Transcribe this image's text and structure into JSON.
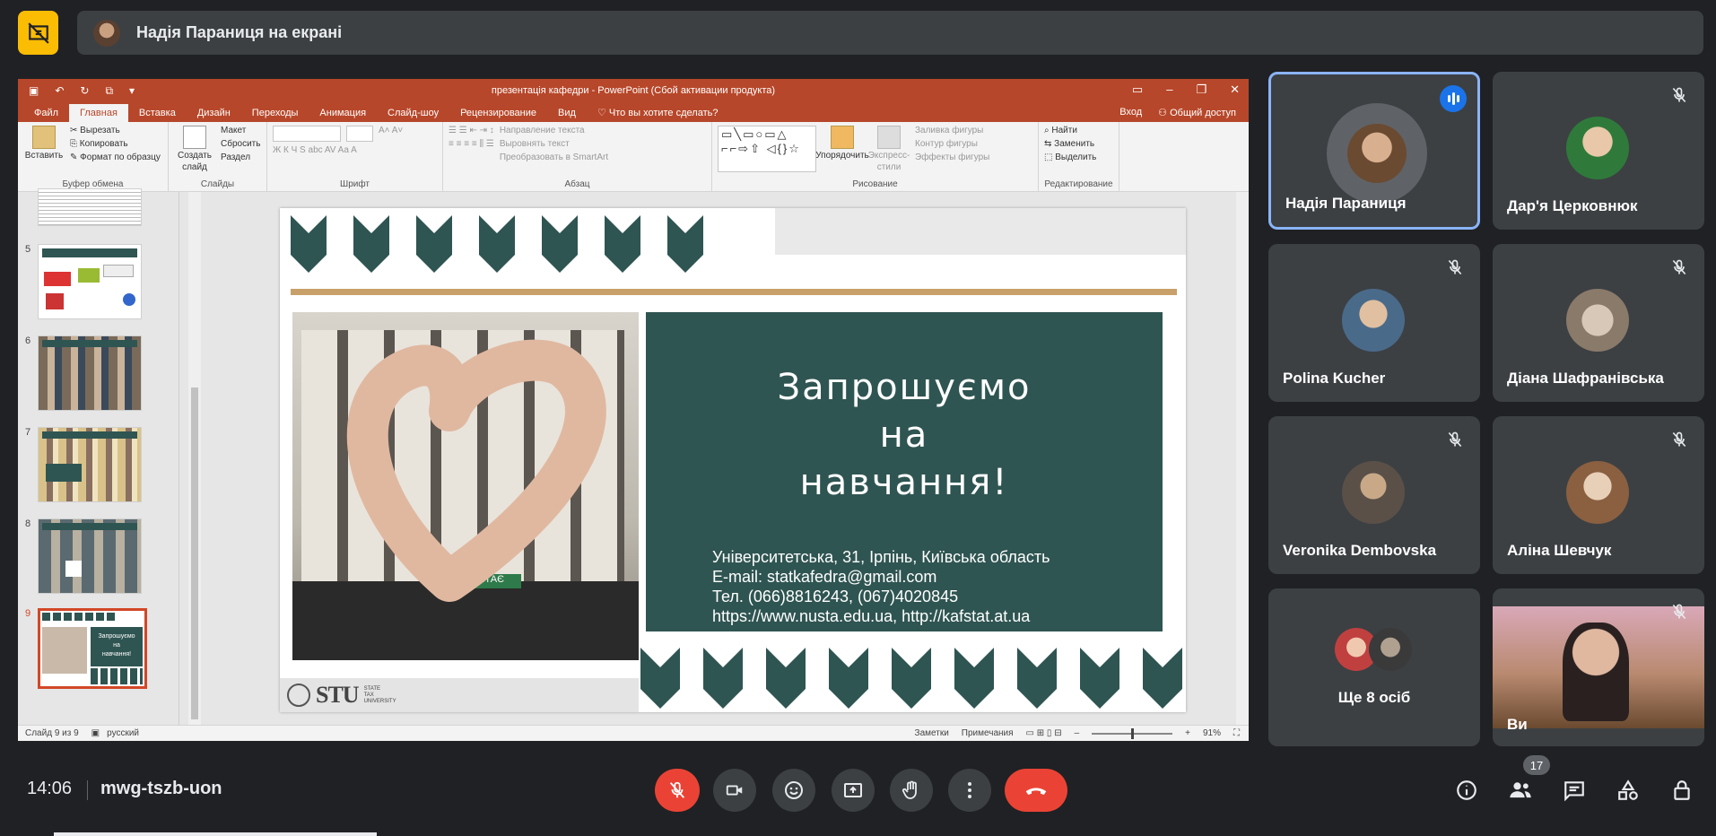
{
  "banner": {
    "text": "Надія Параниця на екрані"
  },
  "ppt": {
    "window_title": "презентація кафедри - PowerPoint (Сбой активации продукта)",
    "menu_tabs": [
      "Файл",
      "Главная",
      "Вставка",
      "Дизайн",
      "Переходы",
      "Анимация",
      "Слайд-шоу",
      "Рецензирование",
      "Вид"
    ],
    "search_hint": "Что вы хотите сделать?",
    "login": "Вход",
    "share": "Общий доступ",
    "ribbon": {
      "paste": "Вставить",
      "cut": "Вырезать",
      "copy": "Копировать",
      "format_painter": "Формат по образцу",
      "group_clipboard": "Буфер обмена",
      "new_slide_1": "Создать",
      "new_slide_2": "слайд",
      "layout": "Макет",
      "reset": "Сбросить",
      "section": "Раздел",
      "group_slides": "Слайды",
      "group_font": "Шрифт",
      "text_direction": "Направление текста",
      "align_text": "Выровнять текст",
      "smartart": "Преобразовать в SmartArt",
      "group_paragraph": "Абзац",
      "arrange_1": "Упорядочить",
      "quick_styles_1": "Экспресс-",
      "quick_styles_2": "стили",
      "shape_fill": "Заливка фигуры",
      "shape_outline": "Контур фигуры",
      "shape_effects": "Эффекты фигуры",
      "group_drawing": "Рисование",
      "find": "Найти",
      "replace": "Заменить",
      "select": "Выделить",
      "group_editing": "Редактирование"
    },
    "thumbnails": [
      {
        "num": "5",
        "active": false
      },
      {
        "num": "6",
        "active": false
      },
      {
        "num": "7",
        "active": false
      },
      {
        "num": "8",
        "active": false
      },
      {
        "num": "9",
        "active": true
      }
    ],
    "slide": {
      "title_line1": "Запрошуємо",
      "title_line2": "на",
      "title_line3": "навчання!",
      "address": "Університетська, 31, Ірпінь, Київська область",
      "email_label": "E-mail: ",
      "email": "statkafedra@gmail.com",
      "phone": "Тел. (066)8816243, (067)4020845",
      "web1": "https://www.nusta.edu.ua",
      "web_sep": ", ",
      "web2": "http://kafstat.at.ua",
      "logo_text": "STU",
      "logo_sub1": "STATE",
      "logo_sub2": "TAX",
      "logo_sub3": "UNIVERSITY",
      "building_sign": "ВІТАЄ"
    },
    "status": {
      "slide_of": "Слайд 9 из 9",
      "language": "русский",
      "notes": "Заметки",
      "comments": "Примечания",
      "zoom": "91%"
    }
  },
  "participants": [
    {
      "name": "Надія Параниця",
      "speaking": true,
      "muted": false
    },
    {
      "name": "Дар'я Церковнюк",
      "speaking": false,
      "muted": true
    },
    {
      "name": "Polina Kucher",
      "speaking": false,
      "muted": true
    },
    {
      "name": "Діана Шафранівська",
      "speaking": false,
      "muted": true
    },
    {
      "name": "Veronika Dembovska",
      "speaking": false,
      "muted": true
    },
    {
      "name": "Аліна Шевчук",
      "speaking": false,
      "muted": true
    },
    {
      "name": "Ще 8 осіб",
      "speaking": false,
      "muted": false
    },
    {
      "name": "Ви",
      "speaking": false,
      "muted": true
    }
  ],
  "bottom": {
    "time": "14:06",
    "meeting_code": "mwg-tszb-uon",
    "people_count": "17"
  },
  "colors": {
    "accent_red": "#ea4335",
    "ppt_orange": "#b7472a",
    "slide_green": "#2f5552",
    "speaking_blue": "#1a73e8",
    "present_yellow": "#fbbc04"
  },
  "icons": [
    "present-off-icon",
    "mic-off-icon",
    "camera-icon",
    "emoji-icon",
    "present-icon",
    "raise-hand-icon",
    "more-icon",
    "end-call-icon",
    "info-icon",
    "people-icon",
    "chat-icon",
    "activities-icon",
    "host-controls-icon"
  ]
}
